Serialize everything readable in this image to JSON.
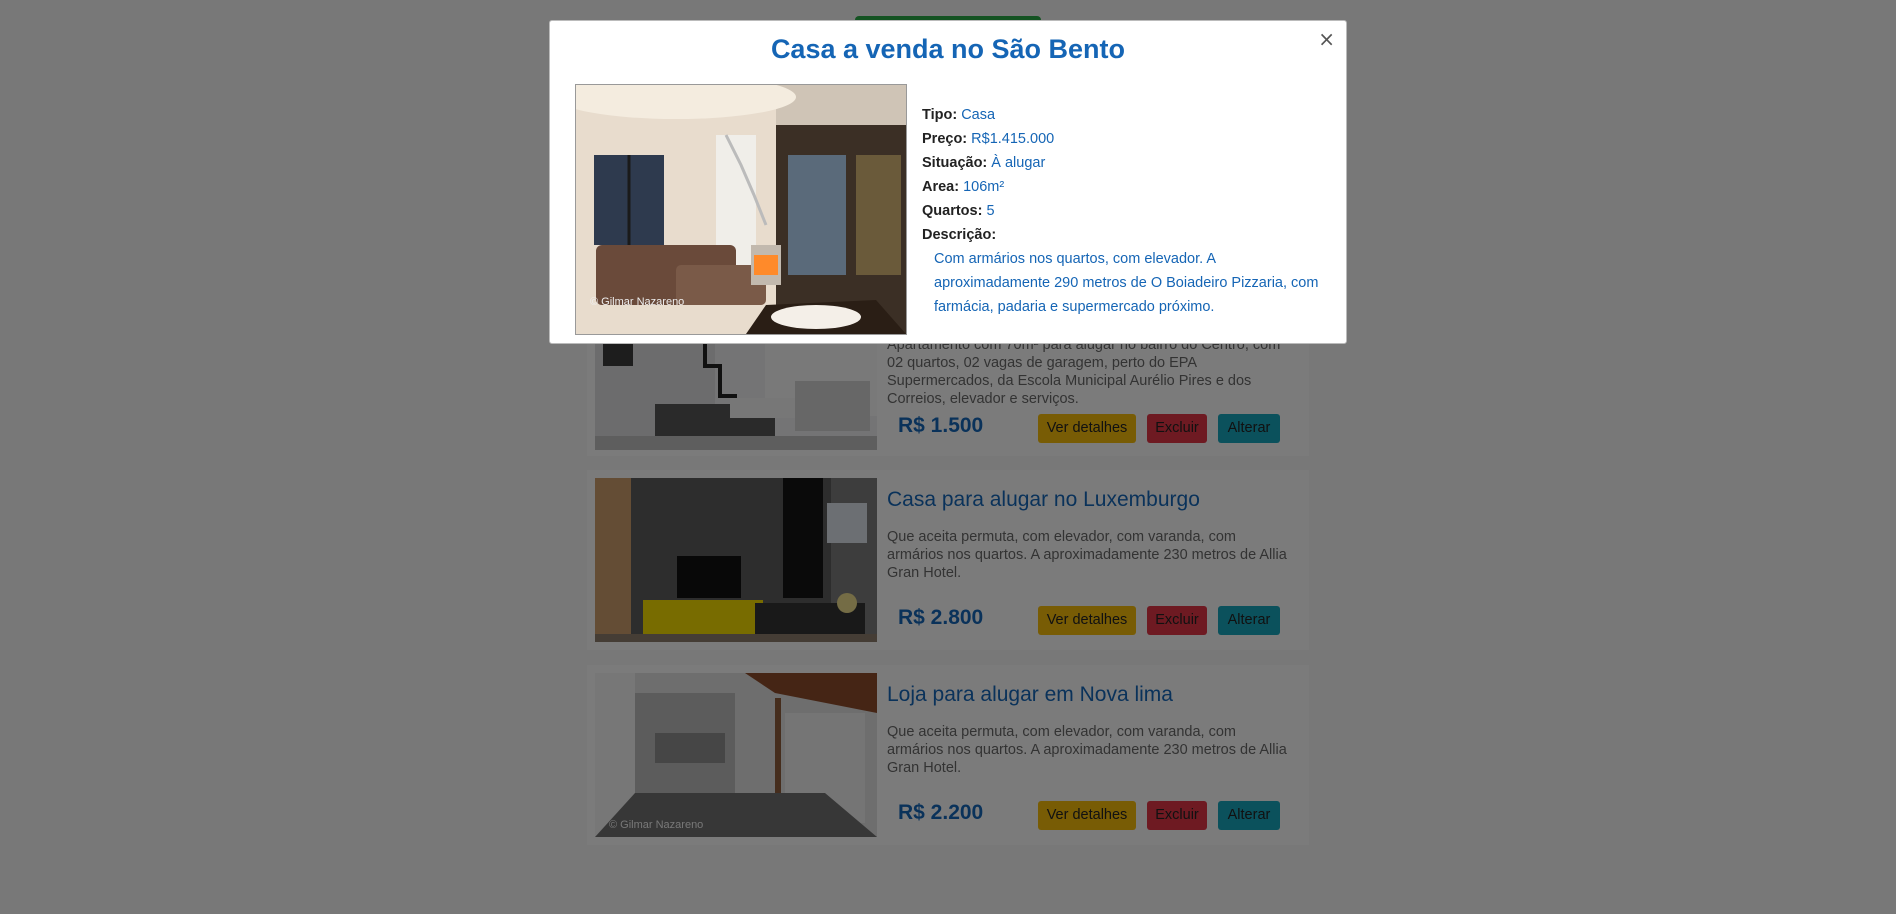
{
  "modal": {
    "title": "Casa a venda no São Bento",
    "close_label": "×",
    "photo_watermark": "© Gilmar Nazareno",
    "fields": {
      "tipo_label": "Tipo:",
      "tipo": "Casa",
      "preco_label": "Preço:",
      "preco": "R$1.415.000",
      "situacao_label": "Situação:",
      "situacao": "À alugar",
      "area_label": "Area:",
      "area": "106m²",
      "quartos_label": "Quartos:",
      "quartos": "5",
      "descricao_label": "Descrição:",
      "descricao": "Com armários nos quartos, com elevador. A aproximadamente 290 metros de O Boiadeiro Pizzaria, com farmácia, padaria e supermercado próximo."
    }
  },
  "listings": [
    {
      "title": "",
      "description": "Apartamento com 70m² para alugar no bairro do Centro, com 02 quartos, 02 vagas de garagem, perto do EPA Supermercados, da Escola Municipal Aurélio Pires e dos Correios, elevador e serviços.",
      "price": "R$ 1.500"
    },
    {
      "title": "Casa para alugar no Luxemburgo",
      "description": "Que aceita permuta, com elevador, com varanda, com armários nos quartos. A aproximadamente 230 metros de Allia Gran Hotel.",
      "price": "R$ 2.800"
    },
    {
      "title": "Loja para alugar em Nova lima",
      "description": "Que aceita permuta, com elevador, com varanda, com armários nos quartos. A aproximadamente 230 metros de Allia Gran Hotel.",
      "price": "R$ 2.200",
      "photo_watermark": "© Gilmar Nazareno"
    }
  ],
  "buttons": {
    "details": "Ver detalhes",
    "delete": "Excluir",
    "edit": "Alterar"
  },
  "colors": {
    "accent": "#1565b5",
    "details": "#f0b90b",
    "delete": "#dc3545",
    "edit": "#17a2b8",
    "top_button": "#28a745"
  }
}
